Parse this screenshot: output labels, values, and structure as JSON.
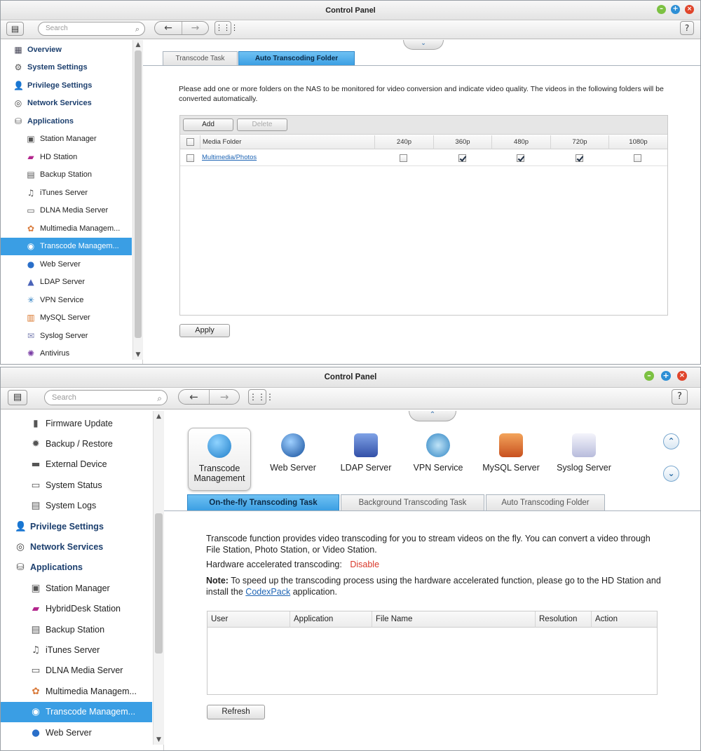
{
  "panel1": {
    "title": "Control Panel",
    "search_placeholder": "Search",
    "help": "?",
    "sidebar": [
      {
        "label": "Overview",
        "icon": "overview-icon",
        "top": true
      },
      {
        "label": "System Settings",
        "icon": "gear-icon",
        "top": true
      },
      {
        "label": "Privilege Settings",
        "icon": "user-icon",
        "top": true
      },
      {
        "label": "Network Services",
        "icon": "network-icon",
        "top": true
      },
      {
        "label": "Applications",
        "icon": "applications-icon",
        "top": true
      },
      {
        "label": "Station Manager",
        "icon": "station-manager-icon"
      },
      {
        "label": "HD Station",
        "icon": "hd-station-icon"
      },
      {
        "label": "Backup Station",
        "icon": "backup-station-icon"
      },
      {
        "label": "iTunes Server",
        "icon": "itunes-icon"
      },
      {
        "label": "DLNA Media Server",
        "icon": "dlna-icon"
      },
      {
        "label": "Multimedia Managem...",
        "icon": "multimedia-icon"
      },
      {
        "label": "Transcode Managem...",
        "icon": "transcode-icon",
        "selected": true
      },
      {
        "label": "Web Server",
        "icon": "globe-icon"
      },
      {
        "label": "LDAP Server",
        "icon": "ldap-icon"
      },
      {
        "label": "VPN Service",
        "icon": "vpn-icon"
      },
      {
        "label": "MySQL Server",
        "icon": "mysql-icon"
      },
      {
        "label": "Syslog Server",
        "icon": "syslog-icon"
      },
      {
        "label": "Antivirus",
        "icon": "antivirus-icon"
      }
    ],
    "tabs": [
      {
        "label": "Transcode Task",
        "active": false
      },
      {
        "label": "Auto Transcoding Folder",
        "active": true
      }
    ],
    "description": "Please add one or more folders on the NAS to be monitored for video conversion and indicate video quality. The videos in the following folders will be converted automatically.",
    "add_label": "Add",
    "delete_label": "Delete",
    "columns": [
      "Media Folder",
      "240p",
      "360p",
      "480p",
      "720p",
      "1080p"
    ],
    "rows": [
      {
        "folder": "Multimedia/Photos",
        "checks": [
          false,
          true,
          true,
          true,
          false
        ]
      }
    ],
    "apply_label": "Apply"
  },
  "panel2": {
    "title": "Control Panel",
    "search_placeholder": "Search",
    "help": "?",
    "sidebar": [
      {
        "label": "Firmware Update",
        "icon": "firmware-icon"
      },
      {
        "label": "Backup / Restore",
        "icon": "backup-restore-icon"
      },
      {
        "label": "External Device",
        "icon": "external-device-icon"
      },
      {
        "label": "System Status",
        "icon": "system-status-icon"
      },
      {
        "label": "System Logs",
        "icon": "system-logs-icon"
      },
      {
        "label": "Privilege Settings",
        "icon": "user-icon",
        "top": true
      },
      {
        "label": "Network Services",
        "icon": "network-icon",
        "top": true
      },
      {
        "label": "Applications",
        "icon": "applications-icon",
        "top": true
      },
      {
        "label": "Station Manager",
        "icon": "station-manager-icon"
      },
      {
        "label": "HybridDesk Station",
        "icon": "hd-station-icon"
      },
      {
        "label": "Backup Station",
        "icon": "backup-station-icon"
      },
      {
        "label": "iTunes Server",
        "icon": "itunes-icon"
      },
      {
        "label": "DLNA Media Server",
        "icon": "dlna-icon"
      },
      {
        "label": "Multimedia Managem...",
        "icon": "multimedia-icon"
      },
      {
        "label": "Transcode Managem...",
        "icon": "transcode-icon",
        "selected": true
      },
      {
        "label": "Web Server",
        "icon": "globe-icon"
      }
    ],
    "apps": [
      {
        "label": "Transcode Management",
        "icon": "transcode-icon",
        "selected": true
      },
      {
        "label": "Web Server",
        "icon": "globe-icon"
      },
      {
        "label": "LDAP Server",
        "icon": "ldap-icon"
      },
      {
        "label": "VPN Service",
        "icon": "vpn-icon"
      },
      {
        "label": "MySQL Server",
        "icon": "mysql-icon"
      },
      {
        "label": "Syslog Server",
        "icon": "syslog-icon"
      }
    ],
    "tabs": [
      {
        "label": "On-the-fly Transcoding Task",
        "active": true
      },
      {
        "label": "Background Transcoding Task",
        "active": false
      },
      {
        "label": "Auto Transcoding Folder",
        "active": false
      }
    ],
    "description": "Transcode function provides video transcoding for you to stream videos on the fly. You can convert a video through File Station, Photo Station, or Video Station.",
    "hw_label": "Hardware accelerated transcoding:",
    "hw_value": "Disable",
    "note_label": "Note:",
    "note_text_1": "To speed up the transcoding process using the hardware accelerated function, please go to the HD Station and install the",
    "note_link": "CodexPack",
    "note_text_2": "application.",
    "columns": [
      "User",
      "Application",
      "File Name",
      "Resolution",
      "Action"
    ],
    "refresh_label": "Refresh"
  },
  "colors": {
    "accent": "#3a9ee4",
    "disable": "#d9382a",
    "link": "#1e64b4"
  }
}
